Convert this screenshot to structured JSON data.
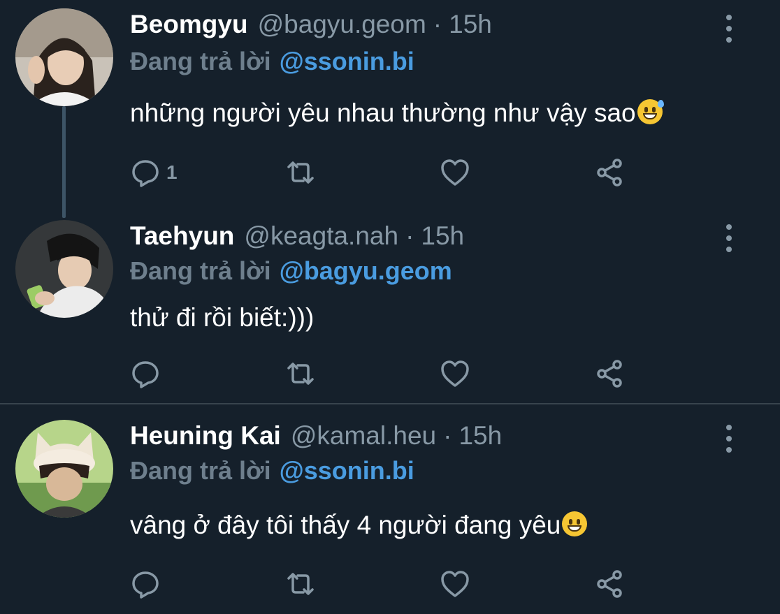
{
  "tweets": [
    {
      "name": "Beomgyu",
      "handle": "@bagyu.geom",
      "separator": "·",
      "time": "15h",
      "replying_prefix": "Đang trả lời",
      "replying_to": "@ssonin.bi",
      "text": "những người yêu nhau thường như vậy sao",
      "emoji": "grinning-sweat-emoji",
      "reply_count": "1"
    },
    {
      "name": "Taehyun",
      "handle": "@keagta.nah",
      "separator": "·",
      "time": "15h",
      "replying_prefix": "Đang trả lời",
      "replying_to": "@bagyu.geom",
      "text": "thử đi rồi biết:)))",
      "reply_count": ""
    },
    {
      "name": "Heuning Kai",
      "handle": "@kamal.heu",
      "separator": "·",
      "time": "15h",
      "replying_prefix": "Đang trả lời",
      "replying_to": "@ssonin.bi",
      "text": "vâng ở đây tôi thấy 4 người đang yêu",
      "emoji": "grinning-emoji",
      "reply_count": ""
    }
  ],
  "icons": {
    "reply": "reply-icon",
    "retweet": "retweet-icon",
    "like": "like-icon",
    "share": "share-icon",
    "more": "more-options-icon"
  },
  "colors": {
    "background": "#15202b",
    "secondary_text": "#8899a6",
    "mention": "#4a9ce0",
    "divider": "#38444d"
  }
}
